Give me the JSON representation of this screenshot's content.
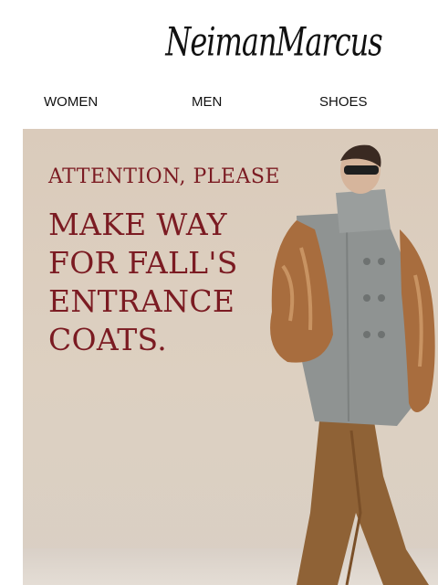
{
  "header": {
    "logo_text": "NeimanMarcus"
  },
  "nav": {
    "items": [
      "WOMEN",
      "MEN",
      "SHOES"
    ]
  },
  "hero": {
    "eyebrow": "ATTENTION, PLEASE",
    "headline_lines": [
      "MAKE WAY",
      "FOR FALL'S",
      "ENTRANCE",
      "COATS."
    ],
    "text_color": "#7b1b22",
    "background_color": "#dacbbb"
  }
}
